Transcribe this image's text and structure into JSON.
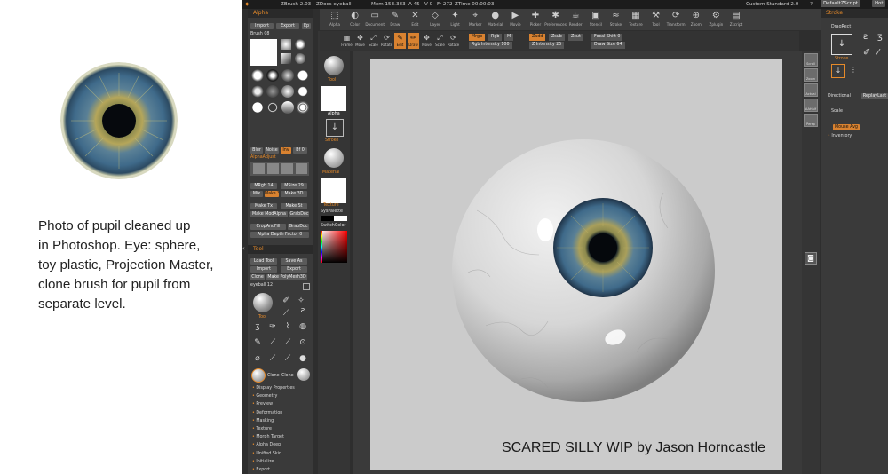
{
  "caption": {
    "lines": [
      "Photo of pupil cleaned up",
      "in Photoshop. Eye: sphere,",
      "toy plastic, Projection Master,",
      "clone brush for pupil from",
      "separate level."
    ]
  },
  "colors": {
    "accent": "#e58a2a",
    "iris_blue": "#3f6a8a",
    "iris_yellow": "#b5a65a",
    "pupil": "#070b10",
    "sclera": "#ececec",
    "ui_dark": "#2e2e2e"
  },
  "app": {
    "topbar": {
      "title": "ZBrush 2.03",
      "doc": "ZDocs eyeball",
      "mem": "Mem 153.383",
      "active": "A 45",
      "points": "V 0",
      "free": "Fr 272",
      "timer": "ZTime 00:00:03",
      "layout": "Custom Standard 2.0",
      "help": "?",
      "script_btn": "DefaultZScript",
      "extra_btn": "Hot"
    },
    "toolshelf": [
      {
        "label": "Alpha",
        "icon": "alpha-icon",
        "glyph": "⬚"
      },
      {
        "label": "Color",
        "icon": "color-icon",
        "glyph": "◐"
      },
      {
        "label": "Document",
        "icon": "document-icon",
        "glyph": "▭"
      },
      {
        "label": "Draw",
        "icon": "draw-icon",
        "glyph": "✎"
      },
      {
        "label": "Edit",
        "icon": "edit-icon",
        "glyph": "✕"
      },
      {
        "label": "Layer",
        "icon": "layer-icon",
        "glyph": "◇"
      },
      {
        "label": "Light",
        "icon": "light-icon",
        "glyph": "✦"
      },
      {
        "label": "Marker",
        "icon": "marker-icon",
        "glyph": "⌖"
      },
      {
        "label": "Material",
        "icon": "material-icon",
        "glyph": "●"
      },
      {
        "label": "Movie",
        "icon": "movie-icon",
        "glyph": "▶"
      },
      {
        "label": "Picker",
        "icon": "picker-icon",
        "glyph": "✚"
      },
      {
        "label": "Preferences",
        "icon": "preferences-icon",
        "glyph": "✱"
      },
      {
        "label": "Render",
        "icon": "render-icon",
        "glyph": "☕"
      },
      {
        "label": "Stencil",
        "icon": "stencil-icon",
        "glyph": "▣"
      },
      {
        "label": "Stroke",
        "icon": "stroke-icon",
        "glyph": "≈"
      },
      {
        "label": "Texture",
        "icon": "texture-icon",
        "glyph": "▦"
      },
      {
        "label": "Tool",
        "icon": "tool-icon",
        "glyph": "⚒"
      },
      {
        "label": "Transform",
        "icon": "transform-icon",
        "glyph": "⟳"
      },
      {
        "label": "Zoom",
        "icon": "zoom-icon",
        "glyph": "⊕"
      },
      {
        "label": "Zplugin",
        "icon": "zplugin-icon",
        "glyph": "⚙"
      },
      {
        "label": "Zscript",
        "icon": "zscript-icon",
        "glyph": "▤"
      }
    ],
    "projection_master": "Projection Master",
    "options": {
      "mrgb": "Mrgb",
      "rgb": "Rgb",
      "m": "M",
      "rgb_intensity": "Rgb Intensity 100",
      "zadd": "Zadd",
      "zsub": "Zsub",
      "zcut": "Zcut",
      "z_intensity": "Z Intensity 25",
      "focal_shift": "Focal Shift 0",
      "draw_size": "Draw Size 64",
      "tools": [
        "Frame",
        "Move",
        "Scale",
        "Rotate",
        "Edit",
        "Draw",
        "Move",
        "Scale",
        "Rotate"
      ]
    },
    "left_palette": {
      "alpha_title": "Alpha",
      "import": "Import",
      "export": "Export",
      "ep": "Ep",
      "brush": "Brush 08",
      "blur": "Blur",
      "noise": "Noise",
      "inv": "Inv",
      "bf": "Bf 0",
      "alpha_adjust": "AlphaAdjust",
      "mrgb": "MRgb 14",
      "msize": "MSize 29",
      "mix": "Mix",
      "make3d": "Make 3D",
      "maketx": "Make Tx",
      "make_st": "Make St",
      "make_modified": "Make ModAlpha",
      "grab_doc": "GrabDoc",
      "crop": "CropAndFill",
      "alpha_depth": "Alpha Depth Factor 0",
      "tool_title": "Tool",
      "load_tool": "Load Tool",
      "save_as": "Save As",
      "import2": "Import",
      "export2": "Export",
      "clone": "Clone",
      "make_polymesh": "Make PolyMesh3D",
      "eyeball": "eyeball 12",
      "tool_label": "Tool",
      "clone_a": "Clone",
      "clone_b": "Clone",
      "menu": [
        "Display Properties",
        "Geometry",
        "Preview",
        "Deformation",
        "Masking",
        "Texture",
        "Morph Target",
        "Alpha Deep",
        "Unified Skin",
        "Initialize",
        "Export"
      ]
    },
    "mid_column": {
      "tool": "Tool",
      "alpha": "Alpha",
      "stroke": "Stroke",
      "material": "Material",
      "texture": "Texture",
      "sys_palette": "SysPalette",
      "switch_color": "SwitchColor"
    },
    "right_shelf": [
      "Scroll",
      "Zoom",
      "Actual",
      "AAHalf",
      "Persp"
    ],
    "right_palette": {
      "title": "Stroke",
      "drag_rect": "DragRect",
      "stroke_label": "Stroke",
      "directional": "Directional",
      "replay_last": "ReplayLast",
      "scale": "Scale",
      "mouse_avg": "Mouse Avg",
      "inventory": "Inventory"
    },
    "watermark": "SCARED SILLY WIP by Jason Horncastle"
  }
}
